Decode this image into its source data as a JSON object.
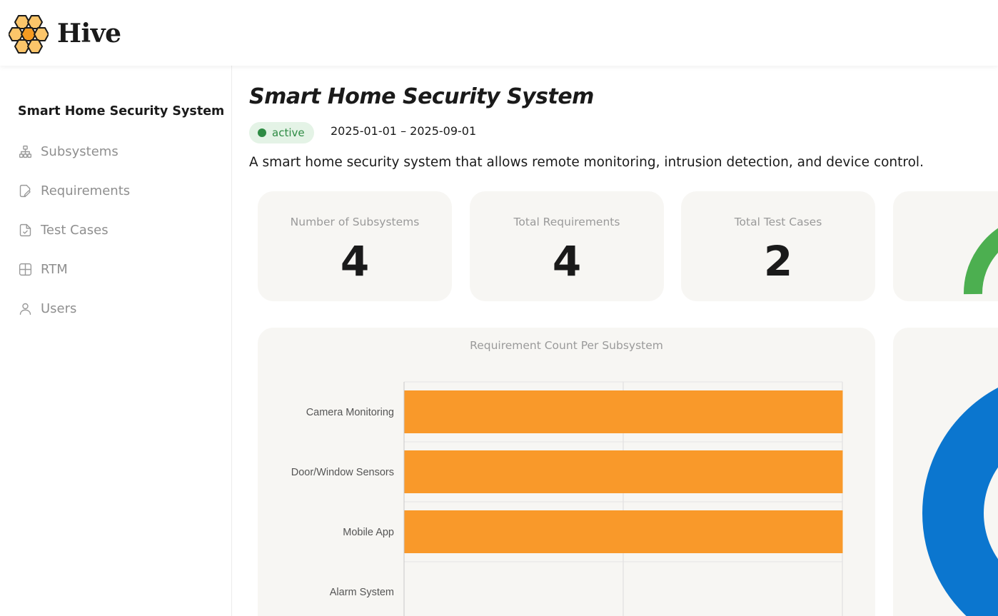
{
  "app": {
    "brand": "Hive"
  },
  "sidebar": {
    "project_name": "Smart Home Security System",
    "items": [
      {
        "label": "Subsystems",
        "icon": "hierarchy-icon"
      },
      {
        "label": "Requirements",
        "icon": "edit-document-icon"
      },
      {
        "label": "Test Cases",
        "icon": "checked-document-icon"
      },
      {
        "label": "RTM",
        "icon": "grid-icon"
      },
      {
        "label": "Users",
        "icon": "user-icon"
      }
    ]
  },
  "project": {
    "title": "Smart Home Security System",
    "status": "active",
    "date_range": "2025-01-01 – 2025-09-01",
    "description": "A smart home security system that allows remote monitoring, intrusion detection, and device control."
  },
  "stats": [
    {
      "label": "Number of Subsystems",
      "value": "4"
    },
    {
      "label": "Total Requirements",
      "value": "4"
    },
    {
      "label": "Total Test Cases",
      "value": "2"
    }
  ],
  "colors": {
    "accent_bar": "#f9992a",
    "status_green": "#2e8b44",
    "gauge_green": "#4caf50",
    "donut_blue": "#0b76cf",
    "card_bg": "#f7f6f3"
  },
  "chart_data": {
    "type": "bar",
    "orientation": "horizontal",
    "title": "Requirement Count Per Subsystem",
    "categories": [
      "Camera Monitoring",
      "Door/Window Sensors",
      "Mobile App",
      "Alarm System"
    ],
    "values": [
      1,
      1,
      1,
      0
    ],
    "xlim": [
      0,
      1
    ],
    "grid": true
  }
}
